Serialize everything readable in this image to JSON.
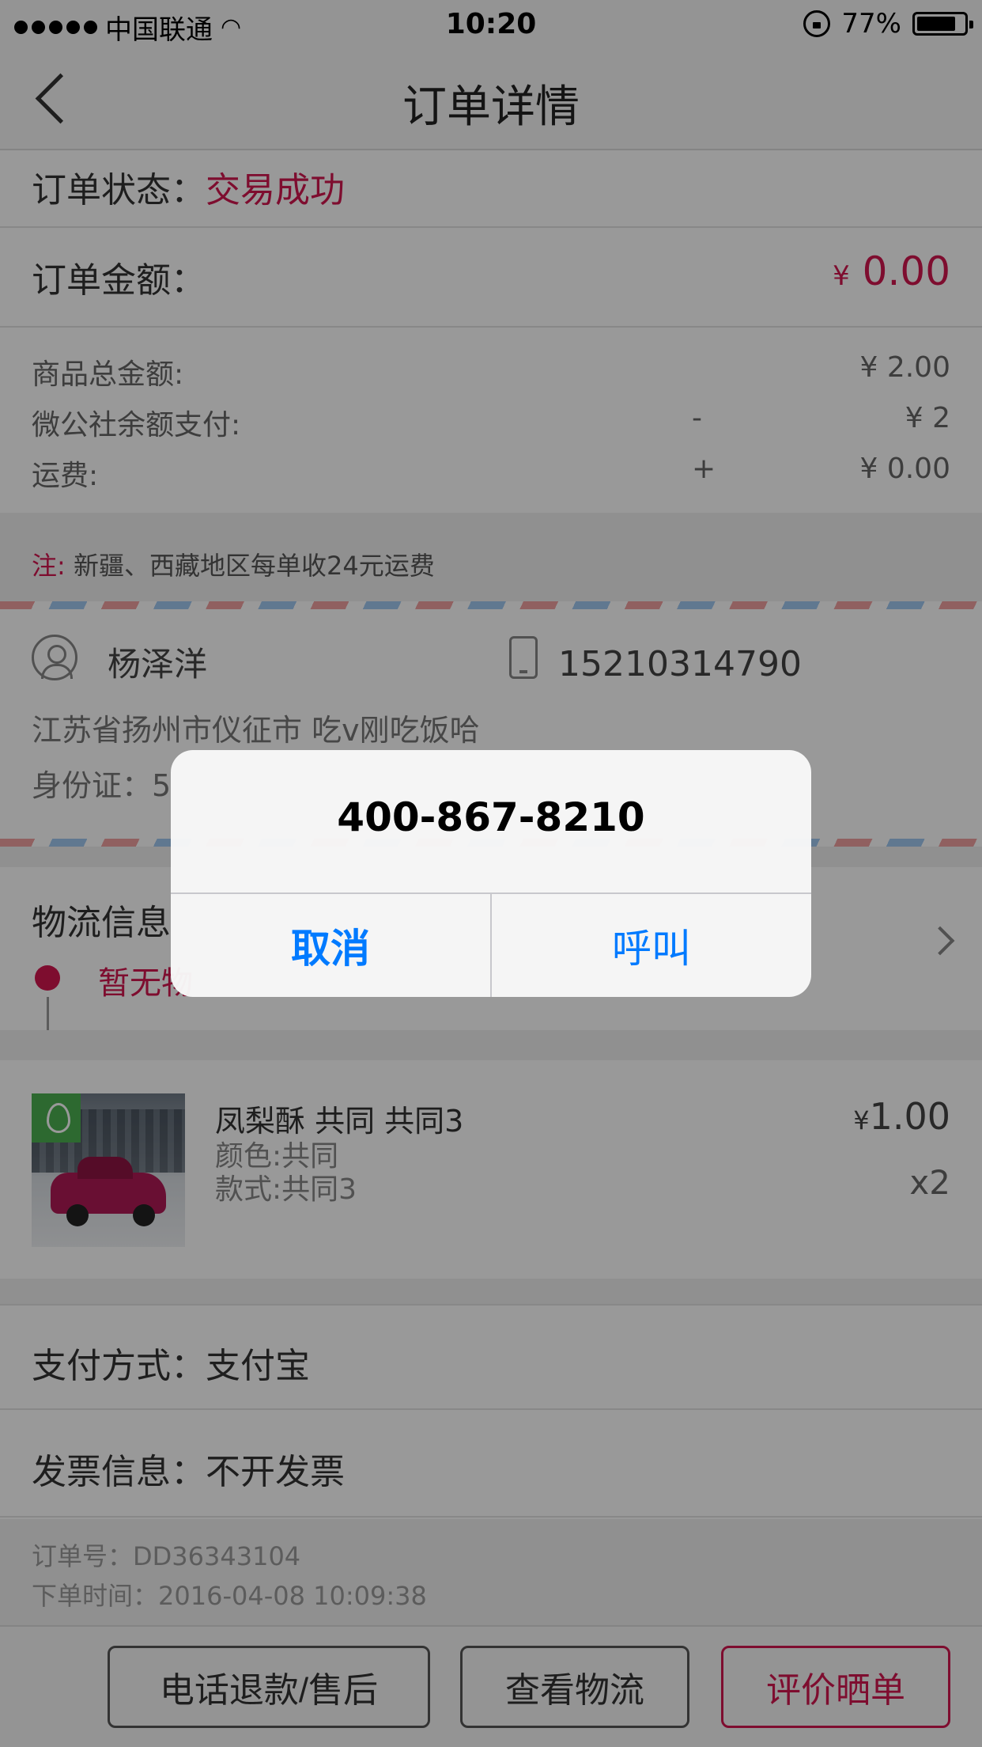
{
  "status_bar": {
    "carrier": "中国联通",
    "time": "10:20",
    "battery": "77%"
  },
  "nav": {
    "title": "订单详情"
  },
  "order_status": {
    "label": "订单状态：",
    "value": "交易成功"
  },
  "order_amount": {
    "label": "订单金额：",
    "currency": "¥",
    "value": "0.00"
  },
  "breakdown": [
    {
      "label": "商品总金额:",
      "sign": "",
      "value": "¥ 2.00"
    },
    {
      "label": "微公社余额支付:",
      "sign": "-",
      "value": "¥ 2"
    },
    {
      "label": "运费:",
      "sign": "+",
      "value": "¥ 0.00"
    }
  ],
  "note": {
    "prefix": "注:",
    "text": "新疆、西藏地区每单收24元运费"
  },
  "address": {
    "name": "杨泽洋",
    "phone": "15210314790",
    "address": "江苏省扬州市仪征市 吃v刚吃饭哈",
    "id_label": "身份证：5"
  },
  "logistics": {
    "title": "物流信息",
    "status": "暂无物"
  },
  "product": {
    "name": "凤梨酥 共同 共同3",
    "attr1": "颜色:共同",
    "attr2": "款式:共同3",
    "currency": "¥",
    "price": "1.00",
    "qty": "x2"
  },
  "payment": {
    "label": "支付方式：",
    "value": "支付宝"
  },
  "invoice": {
    "label": "发票信息：",
    "value": "不开发票"
  },
  "order_info": {
    "order_no": "订单号：DD36343104",
    "order_time": "下单时间：2016-04-08 10:09:38"
  },
  "buttons": {
    "refund": "电话退款/售后",
    "logistics": "查看物流",
    "review": "评价晒单"
  },
  "alert": {
    "message": "400-867-8210",
    "cancel": "取消",
    "call": "呼叫"
  },
  "colors": {
    "accent": "#d2164f",
    "ios_blue": "#007aff"
  }
}
